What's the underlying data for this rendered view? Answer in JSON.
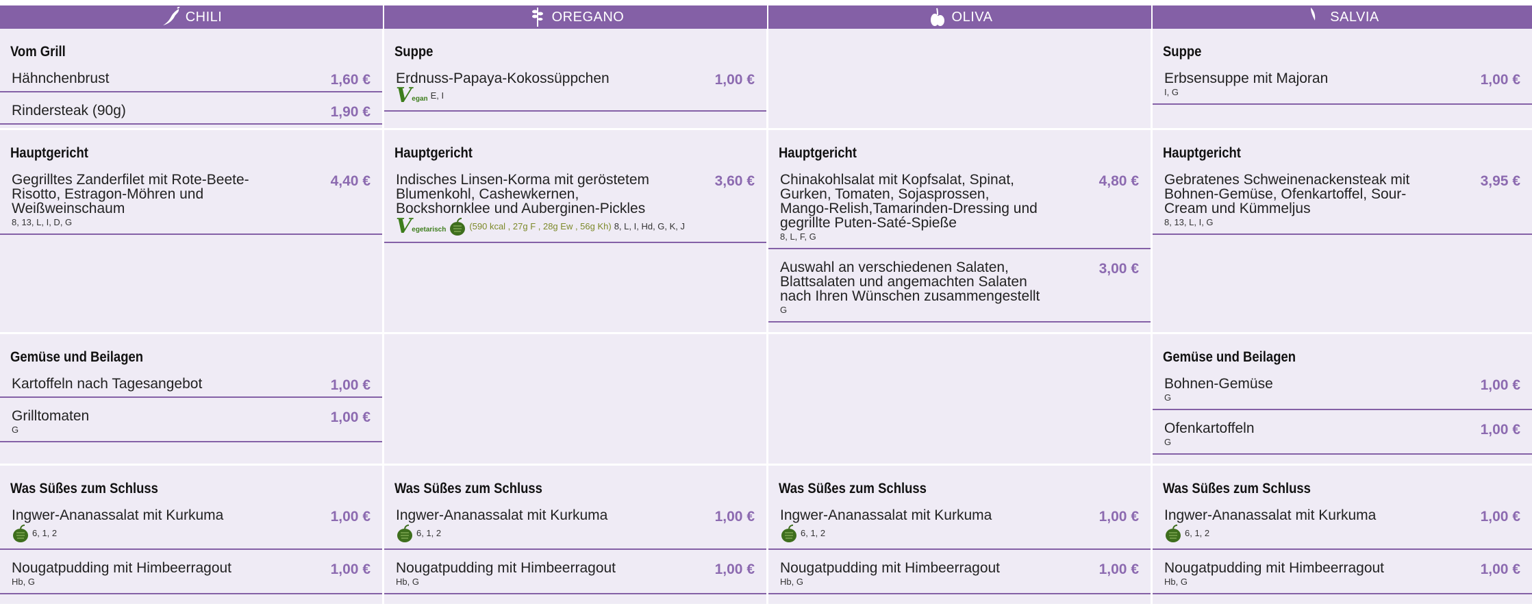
{
  "columns": [
    {
      "name": "CHILI",
      "icon": "chili-icon"
    },
    {
      "name": "OREGANO",
      "icon": "oregano-icon"
    },
    {
      "name": "OLIVA",
      "icon": "olive-icon"
    },
    {
      "name": "SALVIA",
      "icon": "sage-icon"
    }
  ],
  "colors": {
    "header": "#8460a6",
    "cell": "#efebf5",
    "price": "#8c6ab0",
    "vegan": "#3d7d1c",
    "nutrition": "#7d8a2a"
  },
  "chili": {
    "row1": {
      "category": "Vom Grill",
      "items": [
        {
          "name": "Hähnchenbrust",
          "price": "1,60 €",
          "meta": ""
        },
        {
          "name": "Rindersteak (90g)",
          "price": "1,90 €",
          "meta": ""
        }
      ]
    },
    "row2": {
      "category": "Hauptgericht",
      "items": [
        {
          "name": "Gegrilltes Zanderfilet mit Rote-Beete-Risotto, Estragon-Möhren und Weißweinschaum",
          "price": "4,40 €",
          "meta": "8, 13, L, I, D, G"
        }
      ]
    },
    "row3": {
      "category": "Gemüse und Beilagen",
      "items": [
        {
          "name": "Kartoffeln nach Tagesangebot",
          "price": "1,00 €",
          "meta": ""
        },
        {
          "name": "Grilltomaten",
          "price": "1,00 €",
          "meta": "G"
        }
      ]
    },
    "row4": {
      "category": "Was Süßes zum Schluss",
      "items": [
        {
          "name": "Ingwer-Ananassalat mit Kurkuma",
          "price": "1,00 €",
          "meta": "6, 1, 2"
        },
        {
          "name": "Nougatpudding mit Himbeerragout",
          "price": "1,00 €",
          "meta": "Hb, G"
        }
      ]
    }
  },
  "oregano": {
    "row1": {
      "category": "Suppe",
      "items": [
        {
          "name": "Erdnuss-Papaya-Kokossüppchen",
          "price": "1,00 €",
          "badge": "egan",
          "meta": "E, I"
        }
      ]
    },
    "row2": {
      "category": "Hauptgericht",
      "items": [
        {
          "name": "Indisches Linsen-Korma mit geröstetem Blumenkohl, Cashewkernen, Bockshornklee und Auberginen-Pickles",
          "price": "3,60 €",
          "badge": "egetarisch",
          "nutrition": "(590 kcal , 27g F , 28g Ew , 56g Kh)",
          "meta": "8, L, I, Hd, G, K, J"
        }
      ]
    },
    "row4": {
      "category": "Was Süßes zum Schluss",
      "items": [
        {
          "name": "Ingwer-Ananassalat mit Kurkuma",
          "price": "1,00 €",
          "meta": "6, 1, 2"
        },
        {
          "name": "Nougatpudding mit Himbeerragout",
          "price": "1,00 €",
          "meta": "Hb, G"
        }
      ]
    }
  },
  "oliva": {
    "row2": {
      "category": "Hauptgericht",
      "items": [
        {
          "name": "Chinakohlsalat mit Kopfsalat, Spinat, Gurken, Tomaten, Sojasprossen, Mango-Relish,Tamarinden-Dressing und gegrillte Puten-Saté-Spieße",
          "price": "4,80 €",
          "meta": "8, L, F, G"
        },
        {
          "name": "Auswahl an verschiedenen Salaten, Blattsalaten und angemachten Salaten nach Ihren Wünschen zusammengestellt",
          "price": "3,00 €",
          "meta": "G"
        }
      ]
    },
    "row4": {
      "category": "Was Süßes zum Schluss",
      "items": [
        {
          "name": "Ingwer-Ananassalat mit Kurkuma",
          "price": "1,00 €",
          "meta": "6, 1, 2"
        },
        {
          "name": "Nougatpudding mit Himbeerragout",
          "price": "1,00 €",
          "meta": "Hb, G"
        }
      ]
    }
  },
  "salvia": {
    "row1": {
      "category": "Suppe",
      "items": [
        {
          "name": "Erbsensuppe mit Majoran",
          "price": "1,00 €",
          "meta": "I, G"
        }
      ]
    },
    "row2": {
      "category": "Hauptgericht",
      "items": [
        {
          "name": "Gebratenes Schweinenackensteak mit Bohnen-Gemüse, Ofenkartoffel, Sour-Cream und Kümmeljus",
          "price": "3,95 €",
          "meta": "8, 13, L, I, G"
        }
      ]
    },
    "row3": {
      "category": "Gemüse und Beilagen",
      "items": [
        {
          "name": "Bohnen-Gemüse",
          "price": "1,00 €",
          "meta": "G"
        },
        {
          "name": "Ofenkartoffeln",
          "price": "1,00 €",
          "meta": "G"
        }
      ]
    },
    "row4": {
      "category": "Was Süßes zum Schluss",
      "items": [
        {
          "name": "Ingwer-Ananassalat mit Kurkuma",
          "price": "1,00 €",
          "meta": "6, 1, 2"
        },
        {
          "name": "Nougatpudding mit Himbeerragout",
          "price": "1,00 €",
          "meta": "Hb, G"
        }
      ]
    }
  }
}
